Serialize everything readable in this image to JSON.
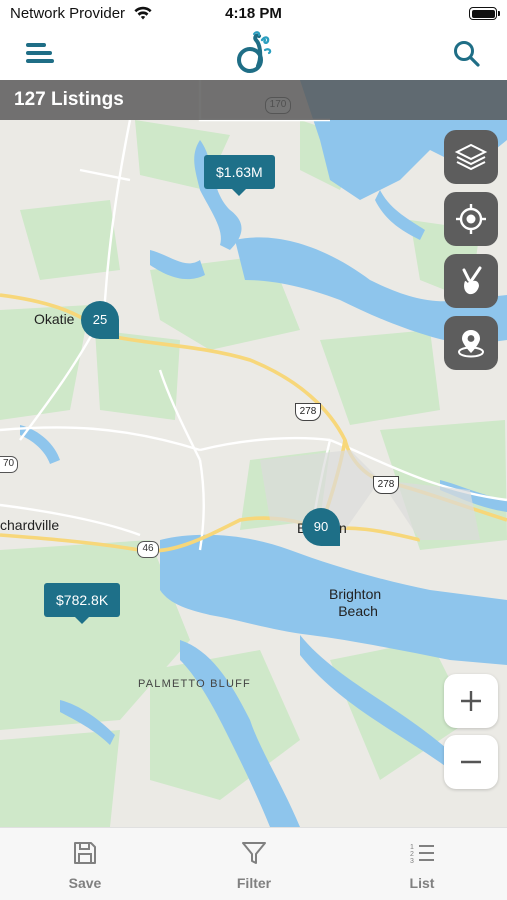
{
  "status_bar": {
    "carrier": "Network Provider",
    "time": "4:18 PM",
    "wifi_icon": "wifi-icon",
    "battery_icon": "battery-icon"
  },
  "nav_bar": {
    "menu_icon": "hamburger-menu-icon",
    "logo": "brand-logo",
    "search_icon": "search-icon",
    "accent_color": "#1f6e86"
  },
  "map": {
    "listing_count": "127 Listings",
    "place_labels": {
      "okatie": "Okatie",
      "hardeeville": "chardville",
      "brighton_beach_line1": "Brighton",
      "brighton_beach_line2": "Beach",
      "palmetto_bluff": "PALMETTO BLUFF",
      "bluffton_fragment": "B",
      "bluffton_fragment_end": "n"
    },
    "road_shields": {
      "sc170_top": "170",
      "us278_a": "278",
      "us278_b": "278",
      "sc46": "46",
      "sc170_left": "70"
    },
    "price_pins": [
      {
        "label": "$1.63M"
      },
      {
        "label": "$782.8K"
      }
    ],
    "cluster_pins": [
      {
        "label": "25"
      },
      {
        "label": "90"
      }
    ],
    "tools": {
      "layers": "layers-icon",
      "locate": "crosshair-locate-icon",
      "draw": "hand-draw-icon",
      "nearby": "map-pin-icon",
      "zoom_in": "+",
      "zoom_out": "−"
    },
    "colors": {
      "land": "#ebeae5",
      "park": "#cfe8c9",
      "water": "#8ec5ec",
      "highway": "#f7d77a",
      "pin": "#1e7089",
      "tool_bg": "#5d5d5d"
    }
  },
  "tab_bar": {
    "tabs": [
      {
        "label": "Save",
        "icon": "save-floppy-icon"
      },
      {
        "label": "Filter",
        "icon": "filter-funnel-icon"
      },
      {
        "label": "List",
        "icon": "list-icon"
      }
    ]
  }
}
